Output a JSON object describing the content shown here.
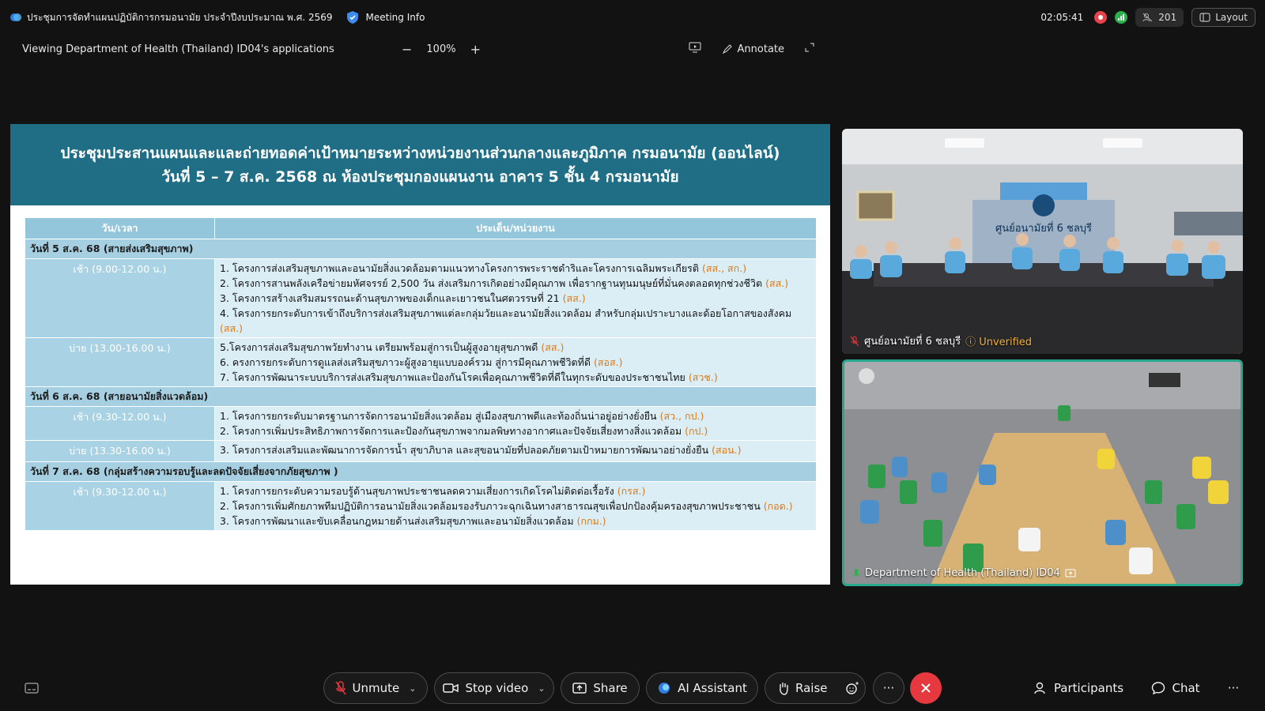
{
  "window": {
    "meeting_title": "ประชุมการจัดทำแผนปฏิบัติการกรมอนามัย ประจำปีงบประมาณ พ.ศ. 2569",
    "meeting_info_label": "Meeting Info",
    "clock": "02:05:41",
    "participants_count": "201",
    "layout_label": "Layout"
  },
  "viewbar": {
    "viewing_text": "Viewing Department of Health (Thailand) ID04's applications",
    "zoom_level": "100%",
    "annotate_label": "Annotate"
  },
  "slide": {
    "title_line1": "ประชุมประสานแผนและและถ่ายทอดค่าเป้าหมายระหว่างหน่วยงานส่วนกลางและภูมิภาค กรมอนามัย (ออนไลน์)",
    "title_line2": "วันที่ 5 – 7 ส.ค. 2568  ณ ห้องประชุมกองแผนงาน อาคาร 5 ชั้น 4 กรมอนามัย",
    "col_time": "วัน/เวลา",
    "col_topic": "ประเด็น/หน่วยงาน",
    "day1_label": "วันที่ 5 ส.ค. 68",
    "day1_theme": "(สายส่งเสริมสุขภาพ)",
    "d1_morning": "เช้า (9.00-12.00 น.)",
    "d1_m_items": [
      {
        "text": "1. โครงการส่งเสริมสุขภาพและอนามัยสิ่งแวดล้อมตามแนวทางโครงการพระราชดำริและโครงการเฉลิมพระเกียรติ ",
        "org": "(สส., สก.)"
      },
      {
        "text": "2. โครงการสานพลังเครือข่ายมหัศจรรย์ 2,500 วัน ส่งเสริมการเกิดอย่างมีคุณภาพ เพื่อรากฐานทุนมนุษย์ที่มั่นคงตลอดทุกช่วงชีวิต ",
        "org": "(สส.)"
      },
      {
        "text": "3. โครงการสร้างเสริมสมรรถนะด้านสุขภาพของเด็กและเยาวชนในศตวรรษที่ 21 ",
        "org": "(สส.)"
      },
      {
        "text": "4. โครงการยกระดับการเข้าถึงบริการส่งเสริมสุขภาพแต่ละกลุ่มวัยและอนามัยสิ่งแวดล้อม สำหรับกลุ่มเปราะบางและด้อยโอกาสของสังคม ",
        "org": "(สส.)"
      }
    ],
    "d1_afternoon": "บ่าย (13.00-16.00 น.)",
    "d1_a_items": [
      {
        "text": "5.โครงการส่งเสริมสุขภาพวัยทำงาน เตรียมพร้อมสู่การเป็นผู้สูงอายุสุขภาพดี ",
        "org": "(สส.)"
      },
      {
        "text": "6. ครงการยกระดับการดูแลส่งเสริมสุขภาวะผู้สูงอายุแบบองค์รวม สู่การมีคุณภาพชีวิตที่ดี ",
        "org": "(สอส.)"
      },
      {
        "text": "7. โครงการพัฒนาระบบบริการส่งเสริมสุขภาพและป้องกันโรคเพื่อคุณภาพชีวิตที่ดีในทุกระดับของประชาชนไทย ",
        "org": "(สวช.)"
      }
    ],
    "day2_label": "วันที่ 6 ส.ค. 68",
    "day2_theme": "(สายอนามัยสิ่งแวดล้อม)",
    "d2_morning": "เช้า (9.30-12.00 น.)",
    "d2_m_items": [
      {
        "text": "1. โครงการยกระดับมาตรฐานการจัดการอนามัยสิ่งแวดล้อม สู่เมืองสุขภาพดีและท้องถิ่นน่าอยู่อย่างยั่งยืน ",
        "org": "(สว., กป.)"
      },
      {
        "text": "2. โครงการเพิ่มประสิทธิภาพการจัดการและป้องกันสุขภาพจากมลพิษทางอากาศและปัจจัยเสี่ยงทางสิ่งแวดล้อม ",
        "org": "(กป.)"
      }
    ],
    "d2_afternoon": "บ่าย (13.30-16.00 น.)",
    "d2_a_items": [
      {
        "text": "3. โครงการส่งเสริมและพัฒนาการจัดการน้ำ สุขาภิบาล และสุขอนามัยที่ปลอดภัยตามเป้าหมายการพัฒนาอย่างยั่งยืน ",
        "org": "(สอน.)"
      }
    ],
    "day3_label": "วันที่ 7 ส.ค. 68",
    "day3_theme": "(กลุ่มสร้างความรอบรู้และลดปัจจัยเสี่ยงจากภัยสุขภาพ )",
    "d3_morning": "เช้า (9.30-12.00 น.)",
    "d3_m_items": [
      {
        "text": "1. โครงการยกระดับความรอบรู้ด้านสุขภาพประชาชนลดความเสี่ยงการเกิดโรคไม่ติดต่อเรื้อรัง ",
        "org": "(กรส.)"
      },
      {
        "text": "2. โครงการเพิ่มศักยภาพทีมปฏิบัติการอนามัยสิ่งแวดล้อมรองรับภาวะฉุกเฉินทางสาธารณสุขเพื่อปกป้องคุ้มครองสุขภาพประชาชน ",
        "org": "(กอด.)"
      },
      {
        "text": "3. โครงการพัฒนาและขับเคลื่อนกฎหมายด้านส่งเสริมสุขภาพและอนามัยสิ่งแวดล้อม ",
        "org": "(กกม.)"
      }
    ]
  },
  "tiles": {
    "tile1_name": "ศูนย์อนามัยที่ 6 ชลบุรี",
    "tile1_sign": "ศูนย์อนามัยที่ 6 ชลบุรี",
    "tile1_status": "Unverified",
    "tile2_name": "Department of Health (Thailand) ID04"
  },
  "toolbar": {
    "unmute": "Unmute",
    "stop_video": "Stop video",
    "share": "Share",
    "ai_assistant": "AI Assistant",
    "raise": "Raise",
    "more": "···",
    "participants": "Participants",
    "chat": "Chat"
  },
  "colors": {
    "slide_header": "#1f6e86",
    "org_accent": "#d97a1b",
    "active_speaker": "#2aa88e",
    "leave": "#e5383f"
  }
}
